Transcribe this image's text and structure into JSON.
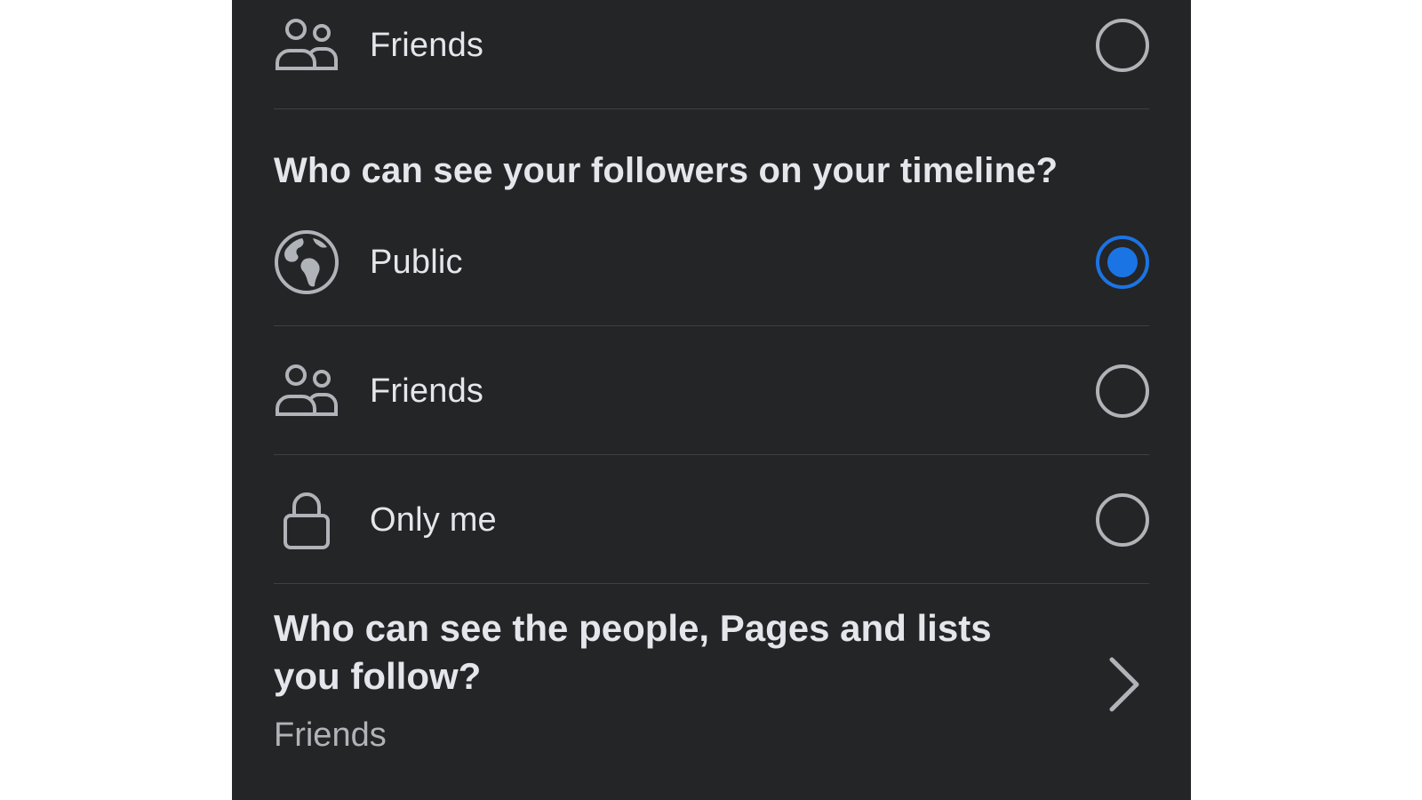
{
  "top_option": {
    "label": "Friends",
    "icon": "friends-icon",
    "selected": false
  },
  "followers_section": {
    "heading": "Who can see your followers on your timeline?",
    "options": [
      {
        "label": "Public",
        "icon": "globe-icon",
        "selected": true
      },
      {
        "label": "Friends",
        "icon": "friends-icon",
        "selected": false
      },
      {
        "label": "Only me",
        "icon": "lock-icon",
        "selected": false
      }
    ]
  },
  "following_setting": {
    "title": "Who can see the people, Pages and lists you follow?",
    "value": "Friends",
    "icon": "chevron-right-icon"
  },
  "colors": {
    "background": "#242527",
    "text": "#e4e6eb",
    "secondary_text": "#b0b3b8",
    "accent": "#1b74e4",
    "divider": "#3e4042"
  }
}
